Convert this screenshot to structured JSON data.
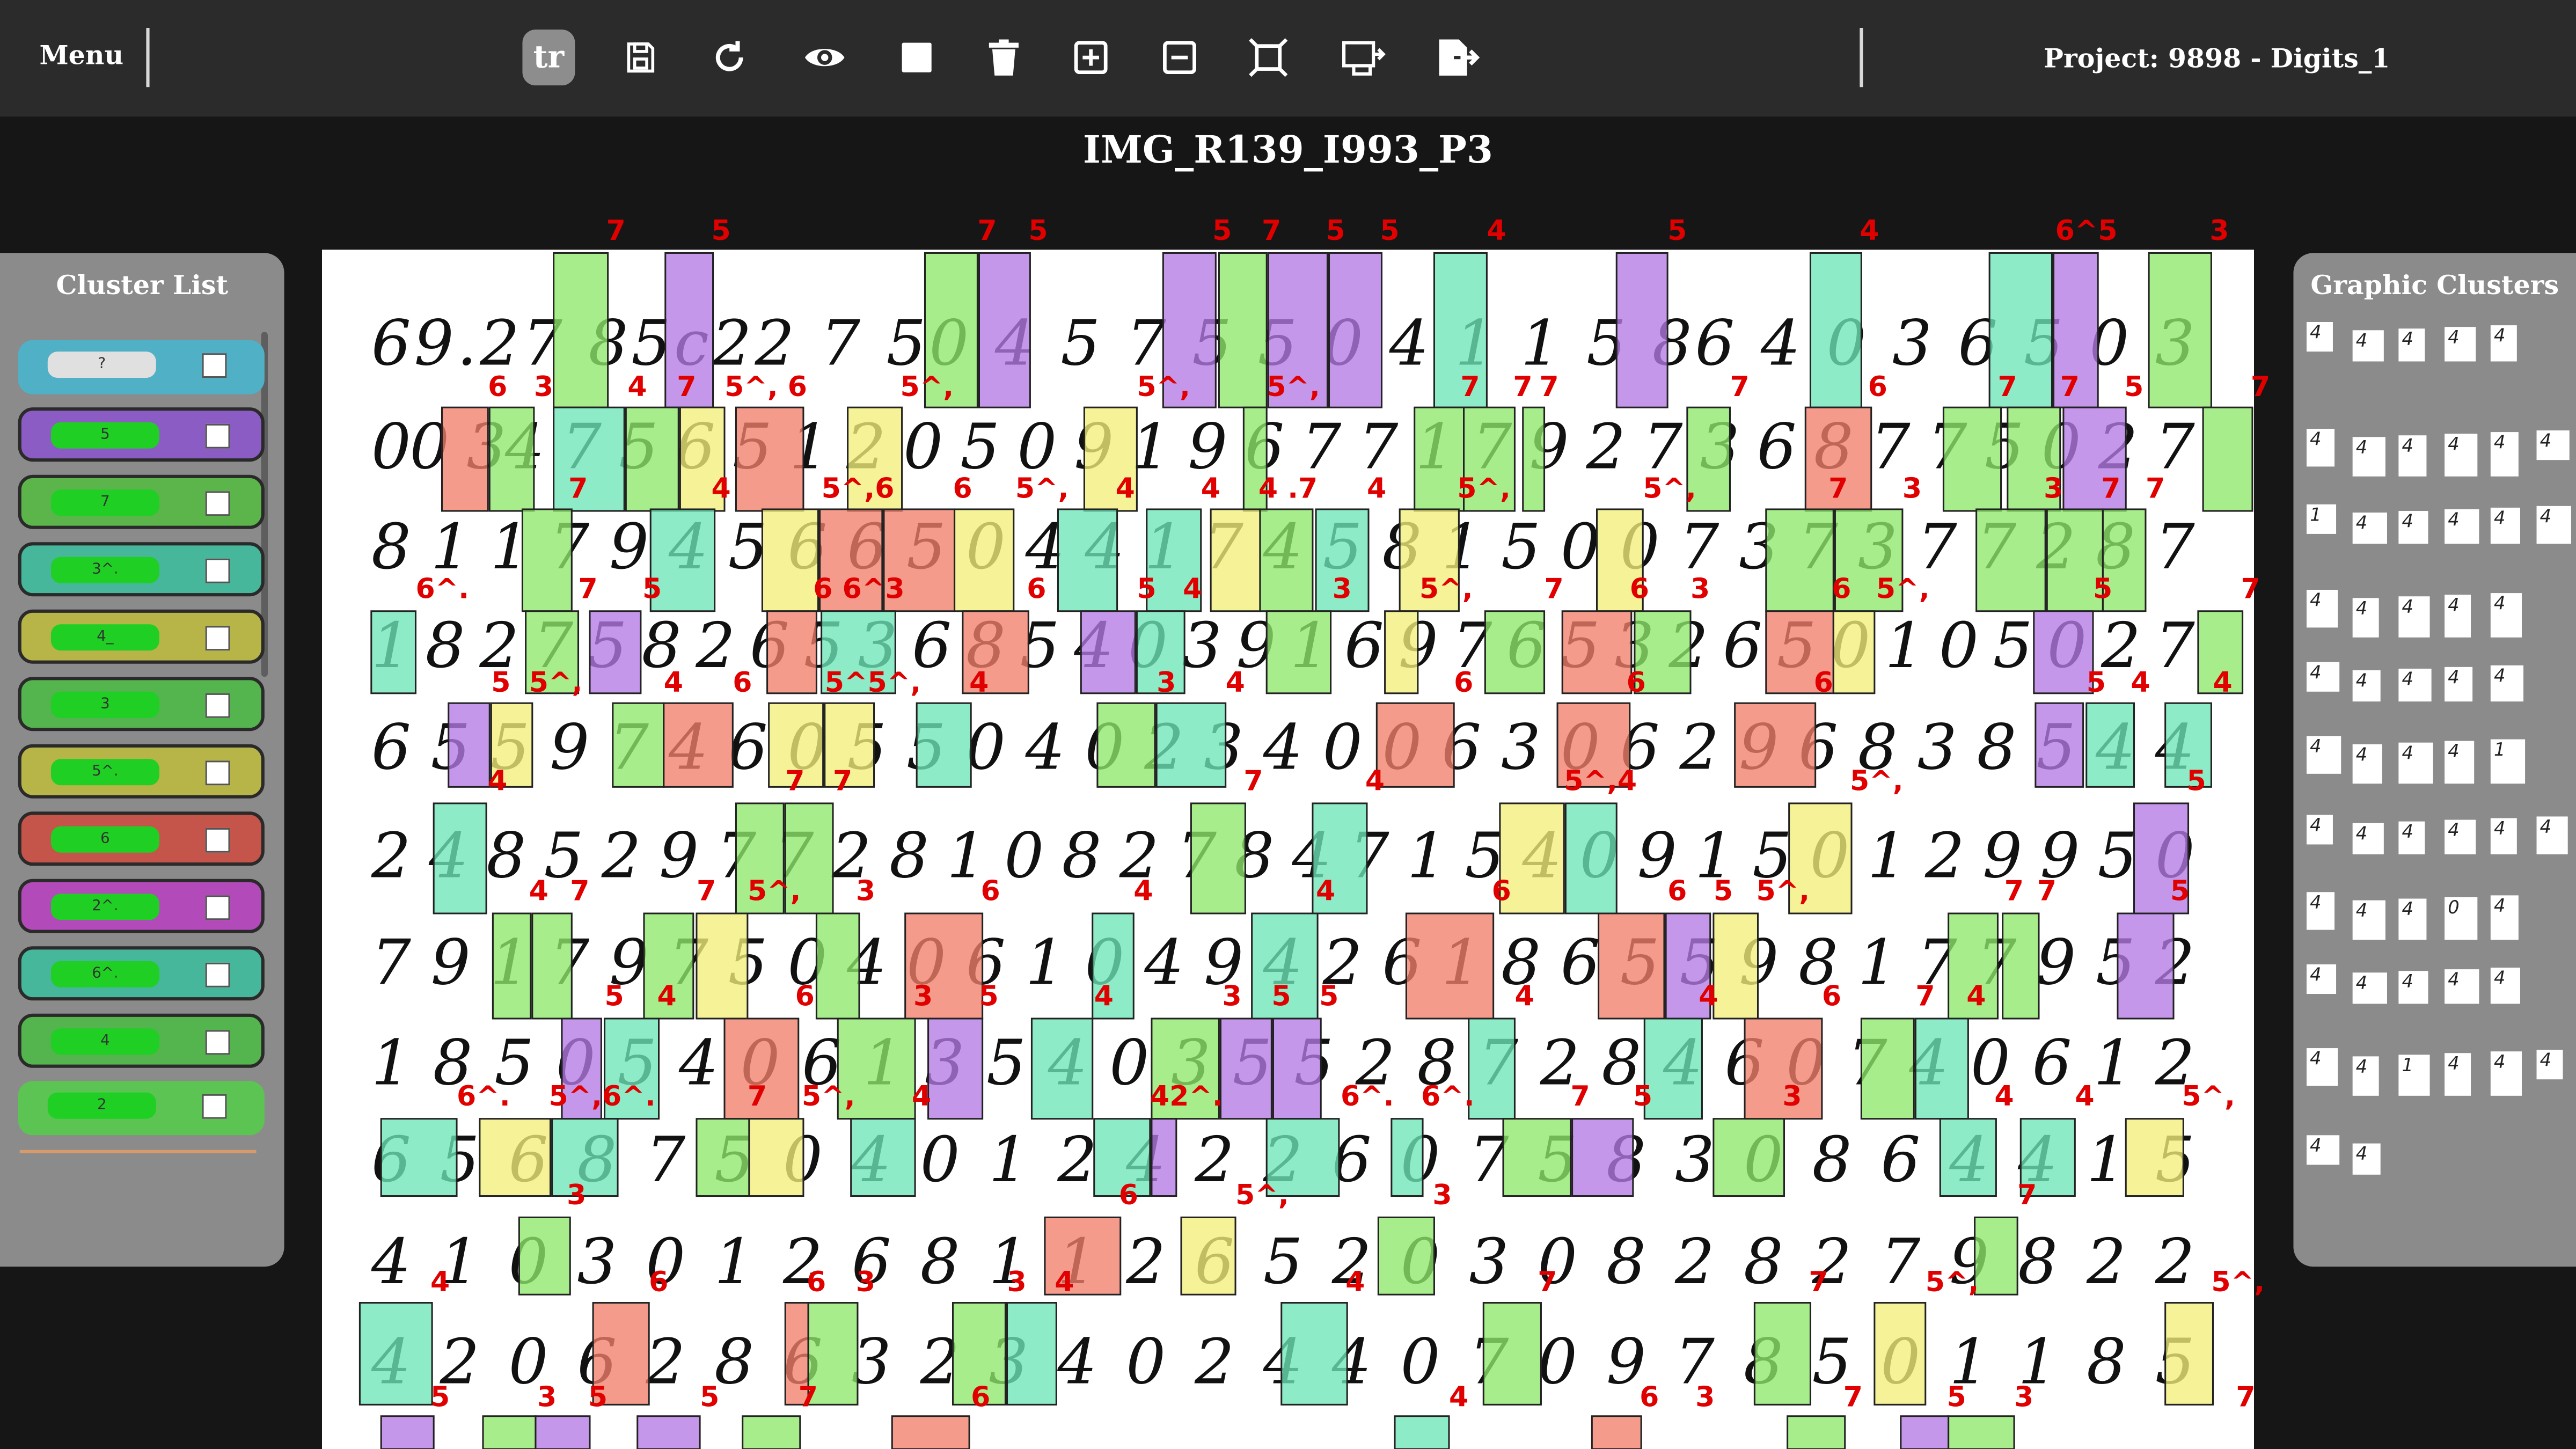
{
  "toolbar": {
    "menu_label": "Menu",
    "project_label": "Project: 9898 - Digits_1",
    "tools": [
      {
        "name": "tr",
        "label": "tr",
        "active": true
      },
      {
        "name": "save",
        "icon": "save-icon"
      },
      {
        "name": "redo",
        "icon": "redo-icon"
      },
      {
        "name": "view",
        "icon": "eye-icon"
      },
      {
        "name": "box",
        "icon": "square-icon"
      },
      {
        "name": "delete",
        "icon": "trash-icon"
      },
      {
        "name": "zoom-in",
        "icon": "zoom-in-icon"
      },
      {
        "name": "zoom-out",
        "icon": "zoom-out-icon"
      },
      {
        "name": "fit",
        "icon": "fit-icon"
      },
      {
        "name": "select-region",
        "icon": "region-icon"
      },
      {
        "name": "export",
        "icon": "export-icon"
      }
    ]
  },
  "image_title": "IMG_R139_I993_P3",
  "cluster_list": {
    "title": "Cluster List",
    "items": [
      {
        "label": "?",
        "color": "#4fb0c6",
        "chip": "#e0e0e0"
      },
      {
        "label": "5",
        "color": "#8b5cc4",
        "chip": "#1fcf24"
      },
      {
        "label": "7",
        "color": "#5cb54a",
        "chip": "#1fcf24"
      },
      {
        "label": "3^.",
        "color": "#46b79a",
        "chip": "#1fcf24"
      },
      {
        "label": "4_",
        "color": "#b8b548",
        "chip": "#1fcf24"
      },
      {
        "label": "3",
        "color": "#54b44e",
        "chip": "#1fcf24"
      },
      {
        "label": "5^.",
        "color": "#b8b548",
        "chip": "#1fcf24"
      },
      {
        "label": "6",
        "color": "#c5544b",
        "chip": "#1fcf24"
      },
      {
        "label": "2^.",
        "color": "#b24ab9",
        "chip": "#1fcf24"
      },
      {
        "label": "6^.",
        "color": "#46b79a",
        "chip": "#1fcf24"
      },
      {
        "label": "4",
        "color": "#54b44e",
        "chip": "#1fcf24"
      },
      {
        "label": "2",
        "color": "#5cc452",
        "chip": "#1fcf24"
      }
    ]
  },
  "graphic_clusters": {
    "title": "Graphic Clusters",
    "rows": [
      [
        "4",
        "4",
        "4",
        "4",
        "4"
      ],
      [
        "4",
        "4",
        "4",
        "4",
        "4",
        "4"
      ],
      [
        "1",
        "4",
        "4",
        "4",
        "4",
        "4"
      ],
      [
        "4",
        "4",
        "4",
        "4",
        "4"
      ],
      [
        "4",
        "4",
        "4",
        "4",
        "4"
      ],
      [
        "4",
        "4",
        "4",
        "4",
        "1"
      ],
      [
        "4",
        "4",
        "4",
        "4",
        "4",
        "4"
      ],
      [
        "4",
        "4",
        "4",
        "0",
        "4"
      ],
      [
        "4",
        "4",
        "4",
        "4",
        "4"
      ],
      [
        "4",
        "4",
        "1",
        "4",
        "4",
        "4"
      ],
      [
        "4",
        "4"
      ]
    ]
  },
  "handwriting_lines": [
    "69.27 85c22 7 50 4 5 7 5 5 0 4 1 1 5 86 4 0 3 6 5 0 3",
    "00 34 7 5 6 5 1 2 0 5 0 9 1 9 6 7 7 1 7 9 2 7 3 6 8 7 7 5 0 2 7",
    "8 1 1 7 9 4 5 6 6 5 0 4 4 1 7 4 5 8 1 5 0 0 7 3 7 3 7 7 2 8 7",
    "1 8 2 7 5 8 2 6 5 3 6 8 5 4 0 3 9 1 6 9 7 6 5 3 2 6 5 0 1 0 5 0 2 7",
    "6 5 5 9 7 4 6 0 5 5 0 4 0 2 3 4 0 0 6 3 0 6 2 9 6 8 3 8 5 4 4",
    "2 4 8 5 2 9 7 7 2 8 1 0 8 2 7 8 4 7 1 5 4 0 9 1 5 0 1 2 9 9 5 0",
    "7 9 1 7 9 7 5 0 4 0 6 1 0 4 9 4 2 6 1 8 6 5 5 9 8 1 7 7 9 5 2",
    "1 8 5 0 5 4 0 6 1 3 5 4 0 3 5 5 2 8 7 2 8 4 6 0 7 4 0 6 1 2",
    "6 5 6 8 7 5 0 4 0 1 2 4 2 2 6 0 7 5 8 3 0 8 6 4 4 1 5",
    "4 1 0 3 0 1 2 6 8 1 1 2 6 5 2 0 3 0 8 2 8 2 7 9 8 2 2",
    "4 2 0 6 2 8 6 3 2 3 4 0 2 4 4 0 7 0 9 7 8 5 0 1 1 8 5"
  ]
}
